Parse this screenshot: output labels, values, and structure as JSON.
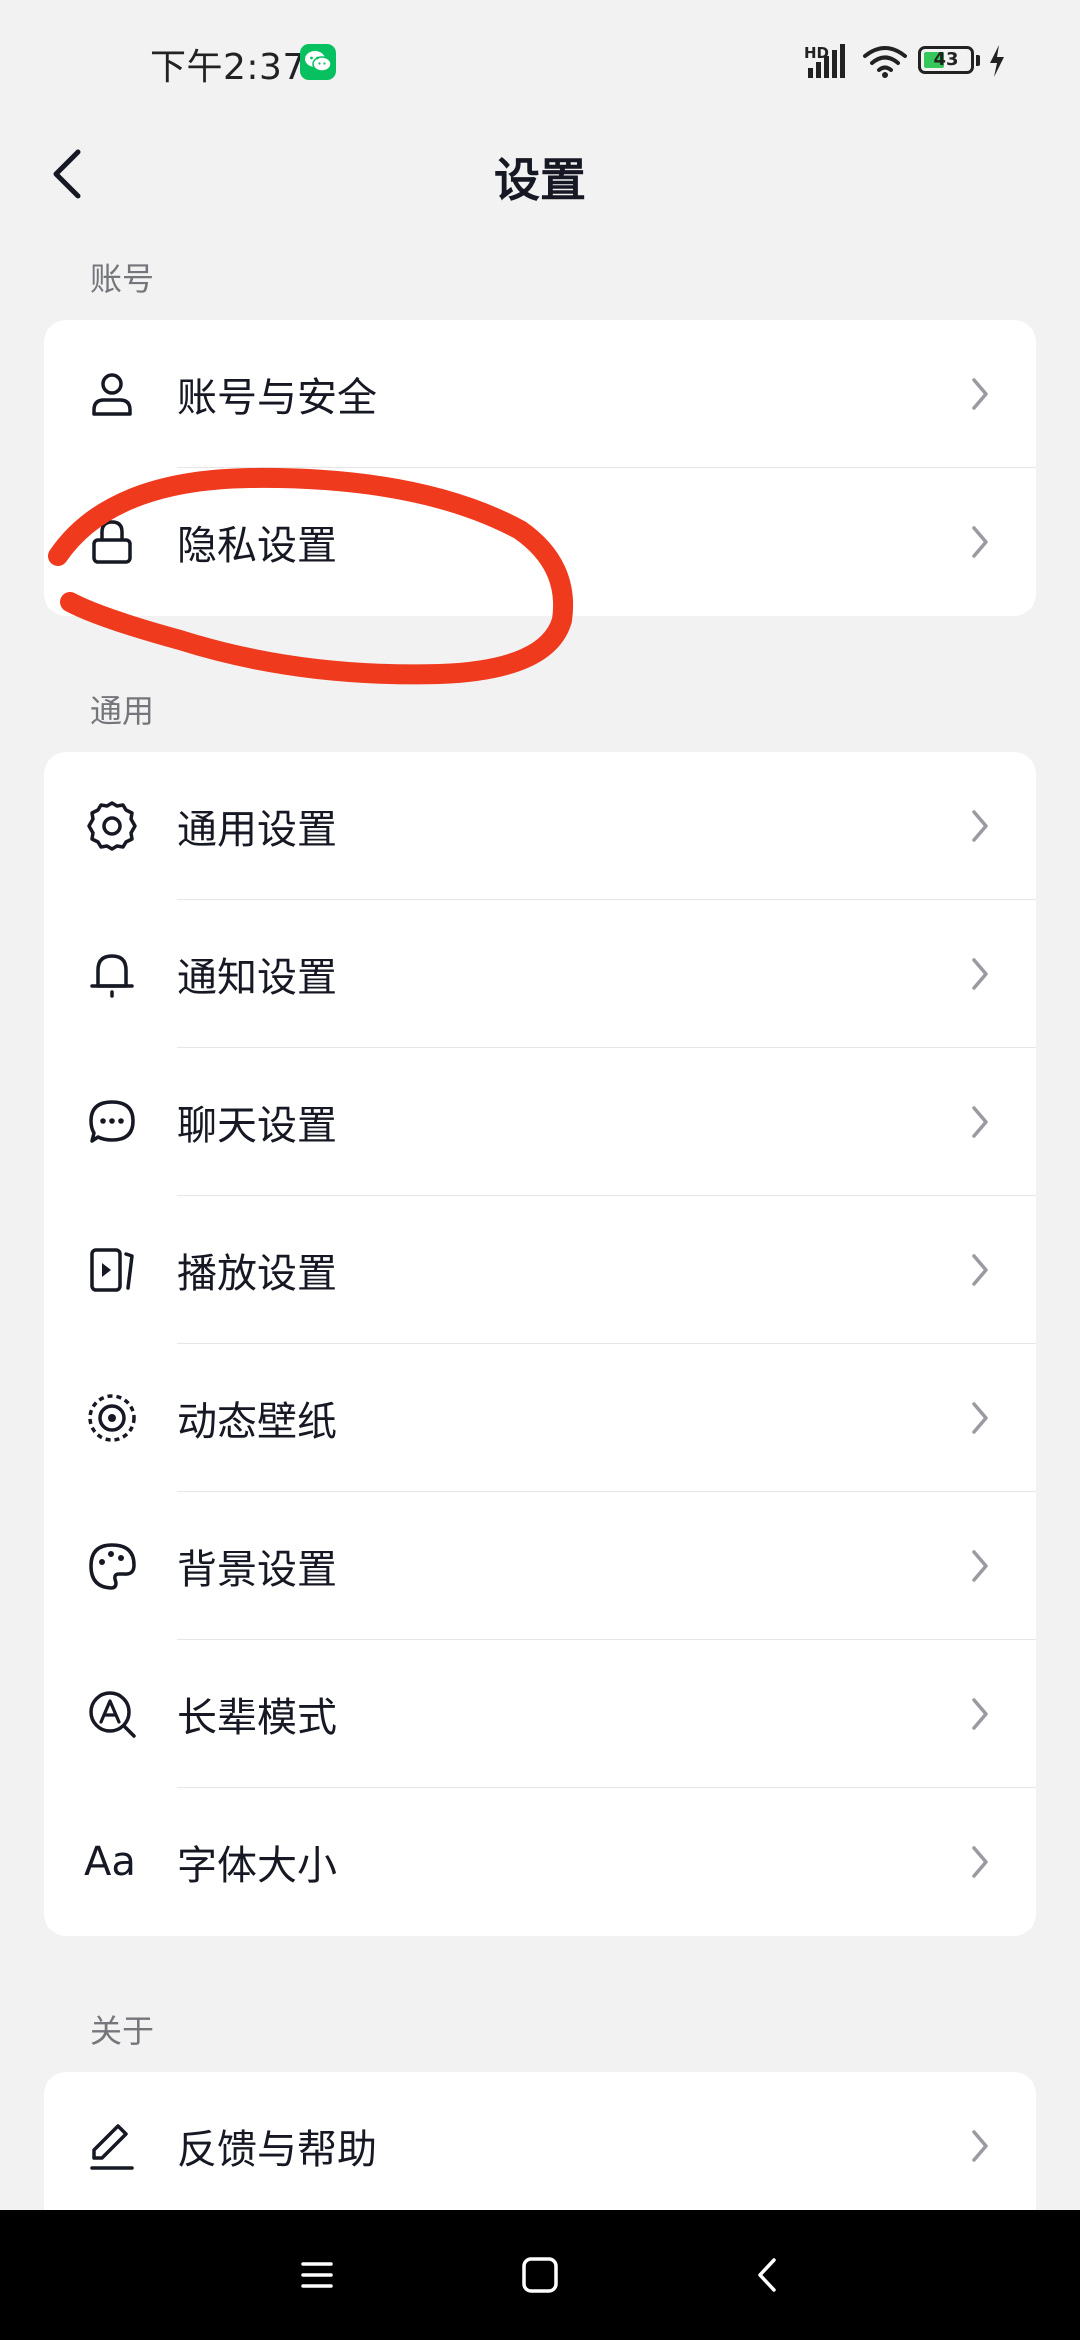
{
  "status_bar": {
    "time": "下午2:37",
    "hd_label": "HD",
    "battery_level": "43",
    "accent_green": "#07c160",
    "icons": [
      "wechat-notification-icon",
      "signal-icon",
      "wifi-icon",
      "battery-icon",
      "charging-bolt-icon"
    ]
  },
  "header": {
    "title": "设置",
    "back_icon": "chevron-left-icon"
  },
  "sections": {
    "account": {
      "label": "账号",
      "items": [
        {
          "label": "账号与安全",
          "icon": "user-icon"
        },
        {
          "label": "隐私设置",
          "icon": "lock-icon"
        }
      ]
    },
    "general": {
      "label": "通用",
      "items": [
        {
          "label": "通用设置",
          "icon": "gear-icon"
        },
        {
          "label": "通知设置",
          "icon": "bell-icon"
        },
        {
          "label": "聊天设置",
          "icon": "chat-bubble-icon"
        },
        {
          "label": "播放设置",
          "icon": "play-screen-icon"
        },
        {
          "label": "动态壁纸",
          "icon": "live-wallpaper-icon"
        },
        {
          "label": "背景设置",
          "icon": "palette-icon"
        },
        {
          "label": "长辈模式",
          "icon": "elder-mode-icon"
        },
        {
          "label": "字体大小",
          "icon": "font-size-icon",
          "icon_text": "Aa"
        }
      ]
    },
    "about": {
      "label": "关于",
      "items": [
        {
          "label": "反馈与帮助",
          "icon": "pencil-icon"
        }
      ]
    }
  },
  "annotation": {
    "color": "#f03a1e",
    "description_icon": "red-hand-drawn-circle"
  },
  "nav_bar": {
    "icons": [
      "menu-icon",
      "home-square-icon",
      "back-triangle-icon"
    ]
  }
}
